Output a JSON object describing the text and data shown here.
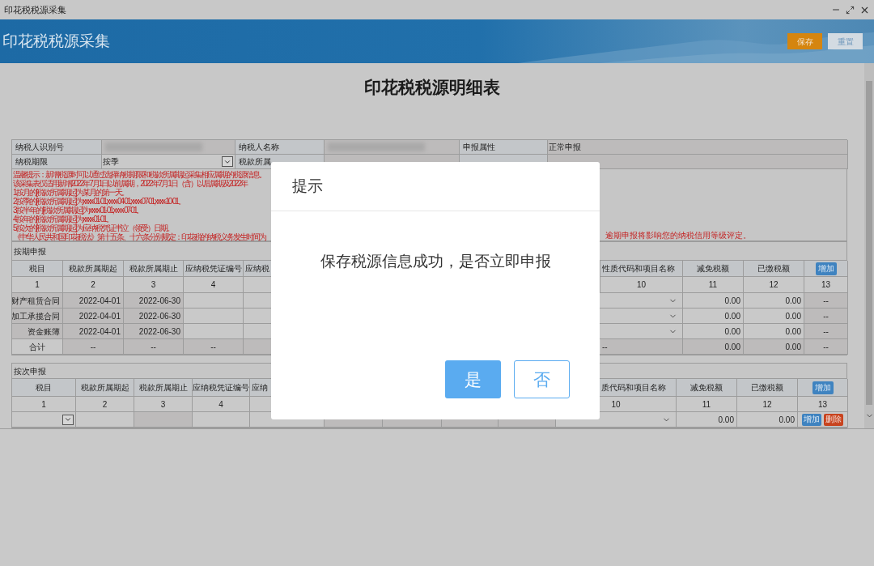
{
  "window": {
    "title": "印花税税源采集"
  },
  "banner": {
    "title": "印花税税源采集",
    "buttons": [
      {
        "label": "保存",
        "kind": "primary"
      },
      {
        "label": "重置",
        "kind": "secondary"
      }
    ]
  },
  "form_title": "印花税税源明细表",
  "info_rows": [
    [
      {
        "kind": "label",
        "text": "纳税人识别号"
      },
      {
        "kind": "redacted"
      },
      {
        "kind": "label",
        "text": "纳税人名称"
      },
      {
        "kind": "redacted"
      },
      {
        "kind": "label",
        "text": "申报属性"
      },
      {
        "kind": "value",
        "text": "正常申报"
      }
    ],
    [
      {
        "kind": "label",
        "text": "纳税期限"
      },
      {
        "kind": "dropdown",
        "text": "按季"
      },
      {
        "kind": "label",
        "text": "税款所属"
      },
      {
        "kind": "value"
      },
      {
        "kind": "label"
      },
      {
        "kind": "value"
      }
    ]
  ],
  "notice": {
    "lines": [
      "温馨提示：新增税源时可以通过选择纳税期限和税款所属期起采集相应属期的税源信息。",
      "该采集表仅适用新增2022年7月1日以前属期，2022年7月1日（含）以后属期及2022年",
      "1.按月的[税款所属期起]为某月的第一天。",
      "2.按季的[税款所属期起]为xxxx-01-01,xxxx-04-01,xxxx-07-01,xxxx-10-01。",
      "3.按半年的[税款所属期起]为xxxx-01-01,xxxx-07-01。",
      "4.按年的[税款所属期起]为xxxx-01-01。",
      "5.按次的[税款所属期起]为应纳税凭证书立（领受）日期。",
      "《中华人民共和国印花税法》第十五条、十六条分别规定：印花税的纳税义务发生时间为"
    ],
    "trailing": "逾期申报将影响您的纳税信用等级评定。"
  },
  "periodic": {
    "title": "按期申报",
    "headers": [
      "税目",
      "税款所属期起",
      "税款所属期止",
      "应纳税凭证编号",
      "应纳税",
      "性质代码和项目名称",
      "减免税额",
      "已缴税额"
    ],
    "add_button": "增加",
    "numbers": [
      "1",
      "2",
      "3",
      "4",
      "10",
      "11",
      "12",
      "13"
    ],
    "rows": [
      {
        "kind": "item",
        "cells": [
          {
            "kind": "readonly",
            "text": "财产租赁合同"
          },
          {
            "kind": "readonly",
            "text": "2022-04-01"
          },
          {
            "kind": "readonly",
            "text": "2022-06-30"
          },
          {
            "kind": "input"
          },
          {
            "kind": "input"
          },
          {
            "kind": "select"
          },
          {
            "kind": "input",
            "text": "0.00"
          },
          {
            "kind": "input",
            "text": "0.00"
          },
          {
            "kind": "readonly",
            "text": "--"
          }
        ]
      },
      {
        "kind": "item",
        "cells": [
          {
            "kind": "readonly",
            "text": "加工承揽合同"
          },
          {
            "kind": "readonly",
            "text": "2022-04-01"
          },
          {
            "kind": "readonly",
            "text": "2022-06-30"
          },
          {
            "kind": "input"
          },
          {
            "kind": "input"
          },
          {
            "kind": "select"
          },
          {
            "kind": "input",
            "text": "0.00"
          },
          {
            "kind": "input",
            "text": "0.00"
          },
          {
            "kind": "readonly",
            "text": "--"
          }
        ]
      },
      {
        "kind": "item",
        "cells": [
          {
            "kind": "readonly",
            "text": "资金账簿"
          },
          {
            "kind": "readonly",
            "text": "2022-04-01"
          },
          {
            "kind": "readonly",
            "text": "2022-06-30"
          },
          {
            "kind": "input"
          },
          {
            "kind": "input"
          },
          {
            "kind": "select"
          },
          {
            "kind": "input",
            "text": "0.00"
          },
          {
            "kind": "input",
            "text": "0.00"
          },
          {
            "kind": "readonly",
            "text": "--"
          }
        ]
      },
      {
        "kind": "total",
        "cells": [
          {
            "kind": "input",
            "text": "合计"
          },
          {
            "kind": "readonly",
            "text": "--"
          },
          {
            "kind": "readonly",
            "text": "--"
          },
          {
            "kind": "readonly",
            "text": "--"
          },
          {
            "kind": "readonly"
          },
          {
            "kind": "readonly",
            "text": "--"
          },
          {
            "kind": "readonly",
            "text": "0.00"
          },
          {
            "kind": "readonly",
            "text": "0.00"
          },
          {
            "kind": "readonly",
            "text": "--"
          }
        ]
      }
    ]
  },
  "per_time": {
    "title": "按次申报",
    "headers": [
      "税目",
      "税款所属期起",
      "税款所属期止",
      "应纳税凭证编号",
      "应纳",
      "质代码和项目名称",
      "减免税额",
      "已缴税额"
    ],
    "add_button": "增加",
    "numbers": [
      "1",
      "2",
      "3",
      "4",
      "10",
      "11",
      "12",
      "13"
    ],
    "rows": [
      {
        "cells": [
          {
            "kind": "dropdown"
          },
          {
            "kind": "input"
          },
          {
            "kind": "readonly"
          },
          {
            "kind": "input"
          },
          {
            "kind": "input"
          },
          {
            "kind": "readonly"
          },
          {
            "kind": "readonly"
          },
          {
            "kind": "readonly"
          },
          {
            "kind": "readonly"
          },
          {
            "kind": "select"
          },
          {
            "kind": "input",
            "text": "0.00"
          },
          {
            "kind": "input",
            "text": "0.00"
          },
          {
            "kind": "buttons",
            "buttons": [
              {
                "label": "增加",
                "kind": "add"
              },
              {
                "label": "删除",
                "kind": "delete"
              }
            ]
          }
        ]
      }
    ]
  },
  "dialog": {
    "title": "提示",
    "message": "保存税源信息成功，是否立即申报",
    "buttons": [
      {
        "label": "是",
        "kind": "primary"
      },
      {
        "label": "否",
        "kind": "secondary"
      }
    ]
  }
}
